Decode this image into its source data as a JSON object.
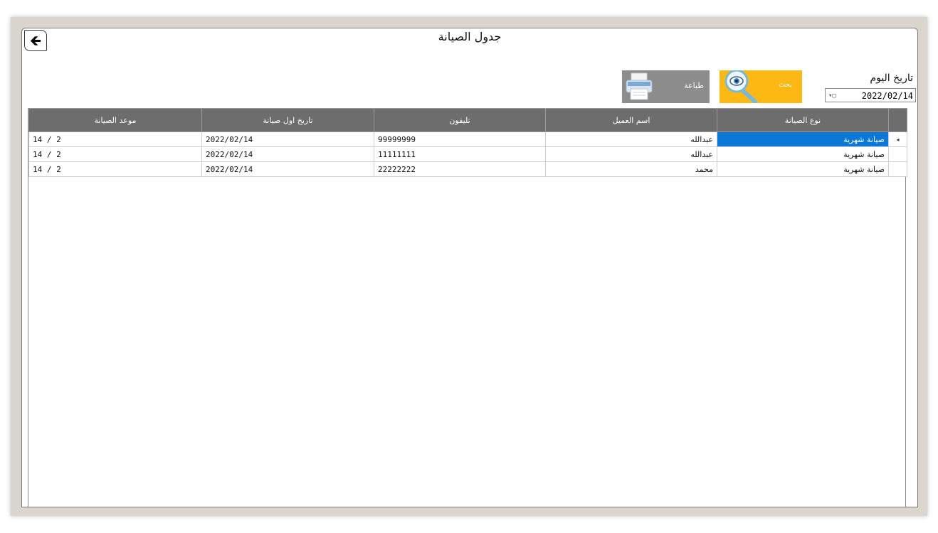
{
  "window": {
    "title": "جدول الصيانة"
  },
  "toolbar": {
    "date_label": "تاريخ اليوم",
    "date_value": "2022/02/14",
    "search_label": "بحث",
    "print_label": "طباعة"
  },
  "icons": {
    "back": "back-arrow-icon",
    "search": "magnifier-eye-icon",
    "print": "printer-icon",
    "calendar": "calendar-dropdown-icon",
    "row_pointer": "row-pointer-icon"
  },
  "colors": {
    "search_button": "#fdb813",
    "print_button": "#8c8c8c",
    "header": "#6d6d6d",
    "selection": "#0b78d7"
  },
  "table": {
    "headers": [
      "نوع الصيانة",
      "اسم العميل",
      "تليفون",
      "تاريخ اول صيانة",
      "موعد الصيانة"
    ],
    "rows": [
      [
        "صيانة شهرية",
        "عبدالله",
        "99999999",
        "2022/02/14",
        "2 / 14"
      ],
      [
        "صيانة شهرية",
        "عبدالله",
        "11111111",
        "2022/02/14",
        "2 / 14"
      ],
      [
        "صيانة شهرية",
        "محمد",
        "22222222",
        "2022/02/14",
        "2 / 14"
      ]
    ]
  }
}
